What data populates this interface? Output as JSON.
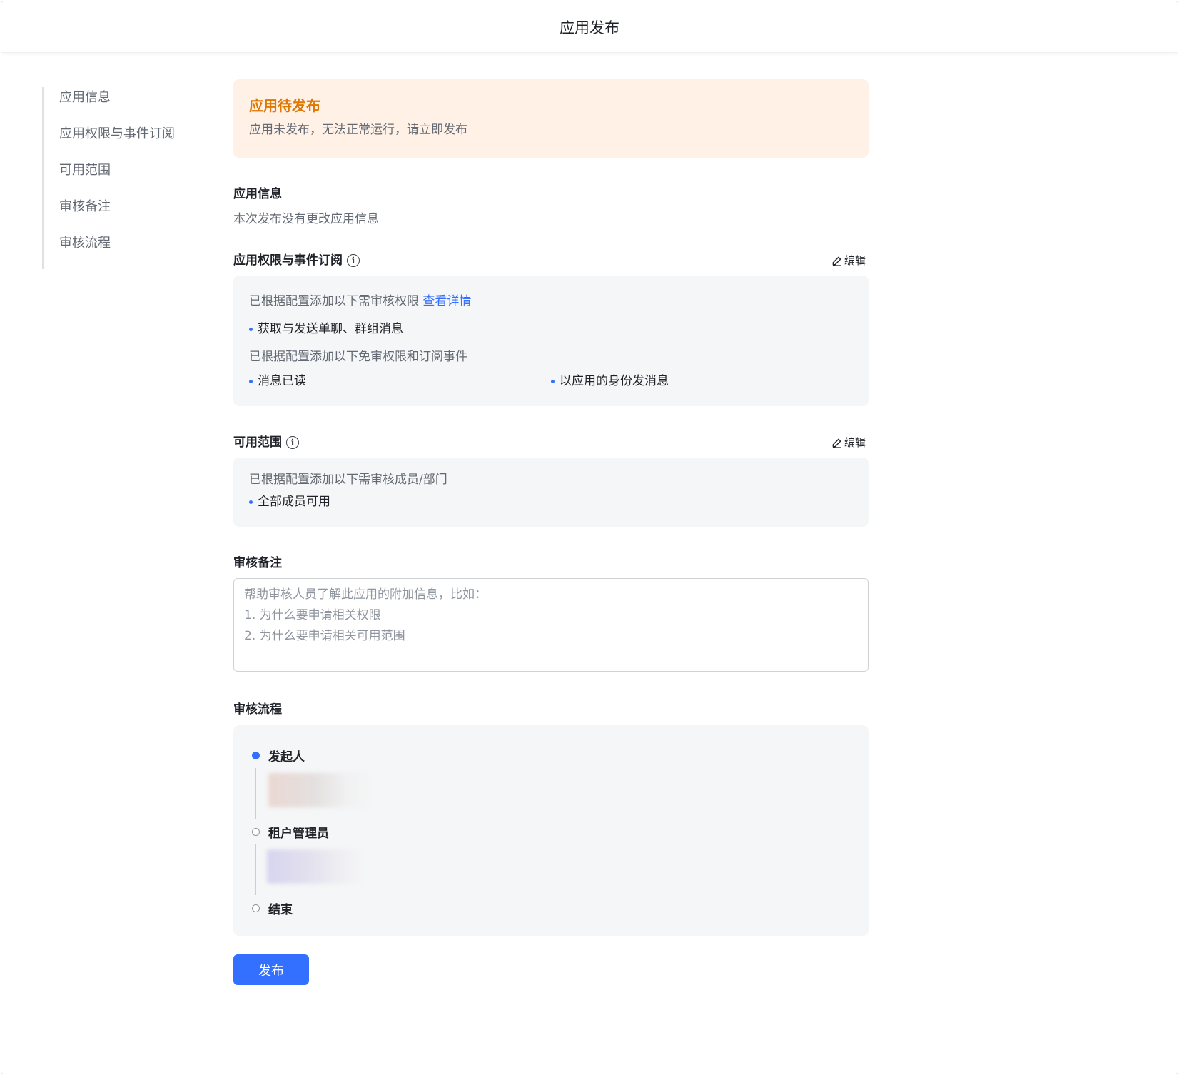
{
  "header": {
    "title": "应用发布"
  },
  "sidebar": {
    "items": [
      {
        "label": "应用信息"
      },
      {
        "label": "应用权限与事件订阅"
      },
      {
        "label": "可用范围"
      },
      {
        "label": "审核备注"
      },
      {
        "label": "审核流程"
      }
    ]
  },
  "alert": {
    "title": "应用待发布",
    "description": "应用未发布，无法正常运行，请立即发布",
    "color": "#de7802",
    "background": "#fff1e6"
  },
  "app_info": {
    "title": "应用信息",
    "text": "本次发布没有更改应用信息"
  },
  "permissions": {
    "title": "应用权限与事件订阅",
    "info_icon": "info-circle-icon",
    "edit_label": "编辑",
    "review_intro": "已根据配置添加以下需审核权限",
    "view_details": "查看详情",
    "review_items": [
      "获取与发送单聊、群组消息"
    ],
    "free_intro": "已根据配置添加以下免审权限和订阅事件",
    "free_items": [
      "消息已读",
      "以应用的身份发消息"
    ]
  },
  "scope": {
    "title": "可用范围",
    "info_icon": "info-circle-icon",
    "edit_label": "编辑",
    "intro": "已根据配置添加以下需审核成员/部门",
    "items": [
      "全部成员可用"
    ]
  },
  "remark": {
    "title": "审核备注",
    "placeholder": "帮助审核人员了解此应用的附加信息，比如：\n1. 为什么要申请相关权限\n2. 为什么要申请相关可用范围",
    "value": ""
  },
  "flow": {
    "title": "审核流程",
    "steps": [
      {
        "label": "发起人",
        "active": true
      },
      {
        "label": "租户管理员",
        "active": false
      },
      {
        "label": "结束",
        "active": false
      }
    ]
  },
  "actions": {
    "publish_label": "发布",
    "primary_color": "#3370ff"
  }
}
